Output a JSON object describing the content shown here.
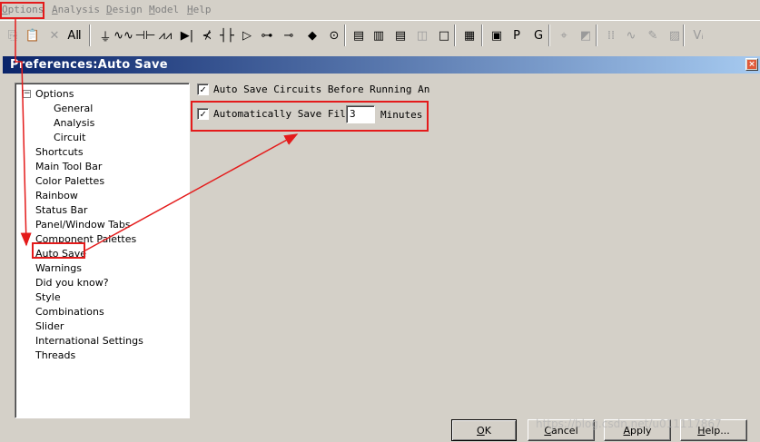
{
  "menubar": {
    "items": [
      {
        "label": "Options",
        "mnemonic": "O",
        "rest": "ptions"
      },
      {
        "label": "Analysis",
        "mnemonic": "A",
        "rest": "nalysis"
      },
      {
        "label": "Design",
        "mnemonic": "D",
        "rest": "esign"
      },
      {
        "label": "Model",
        "mnemonic": "M",
        "rest": "odel"
      },
      {
        "label": "Help",
        "mnemonic": "H",
        "rest": "elp"
      }
    ]
  },
  "toolbar": {
    "icons": [
      {
        "name": "copy-icon",
        "glyph": "⎘",
        "dim": true
      },
      {
        "name": "paste-icon",
        "glyph": "📋",
        "dim": false
      },
      {
        "name": "delete-icon",
        "glyph": "✕",
        "dim": true
      },
      {
        "name": "all-text-icon",
        "glyph": "AⅡ",
        "dim": false
      },
      {
        "name": "ground-icon",
        "glyph": "⏚",
        "dim": false
      },
      {
        "name": "inductor-icon",
        "glyph": "∿∿",
        "dim": false
      },
      {
        "name": "capacitor-icon",
        "glyph": "⊣⊢",
        "dim": false
      },
      {
        "name": "resistor-icon",
        "glyph": "⩘⩘",
        "dim": false
      },
      {
        "name": "diode-icon",
        "glyph": "▶|",
        "dim": false
      },
      {
        "name": "transistor-icon",
        "glyph": "⊀",
        "dim": false
      },
      {
        "name": "mosfet-icon",
        "glyph": "┤├",
        "dim": false
      },
      {
        "name": "opamp-icon",
        "glyph": "▷",
        "dim": false
      },
      {
        "name": "switch-icon",
        "glyph": "⊶",
        "dim": false
      },
      {
        "name": "wire-junction-icon",
        "glyph": "⊸",
        "dim": false
      },
      {
        "name": "node-icon",
        "glyph": "◆",
        "dim": false
      },
      {
        "name": "source-icon",
        "glyph": "⊙",
        "dim": false
      },
      {
        "name": "cascade-windows-icon",
        "glyph": "▤",
        "dim": false
      },
      {
        "name": "tile-vertical-icon",
        "glyph": "▥",
        "dim": false
      },
      {
        "name": "tile-horizontal-icon",
        "glyph": "▤",
        "dim": false
      },
      {
        "name": "split-window-icon",
        "glyph": "◫",
        "dim": true
      },
      {
        "name": "window-icon",
        "glyph": "□",
        "dim": false
      },
      {
        "name": "calculator-icon",
        "glyph": "▦",
        "dim": false
      },
      {
        "name": "schematic-window-icon",
        "glyph": "▣",
        "dim": false
      },
      {
        "name": "page-icon",
        "glyph": "P",
        "dim": false
      },
      {
        "name": "graph-icon",
        "glyph": "G",
        "dim": false
      },
      {
        "name": "probe-icon",
        "glyph": "⌖",
        "dim": true
      },
      {
        "name": "image-icon",
        "glyph": "◩",
        "dim": true
      },
      {
        "name": "grid-dots-icon",
        "glyph": "⁞⁞",
        "dim": true
      },
      {
        "name": "waveform-icon",
        "glyph": "∿",
        "dim": true
      },
      {
        "name": "pencil-icon",
        "glyph": "✎",
        "dim": true
      },
      {
        "name": "picture-icon",
        "glyph": "▨",
        "dim": true
      },
      {
        "name": "voltage-icon",
        "glyph": "Vᵢ",
        "dim": true
      }
    ]
  },
  "dialog": {
    "title": "Preferences:Auto Save",
    "tree": {
      "root": "Options",
      "toggle": "−",
      "items": [
        "General",
        "Analysis",
        "Circuit",
        "Shortcuts",
        "Main Tool Bar",
        "Color Palettes",
        "Rainbow",
        "Status Bar",
        "Panel/Window Tabs",
        "Component Palettes",
        "Auto Save",
        "Warnings",
        "Did you know?",
        "Style",
        "Combinations",
        "Slider",
        "International Settings",
        "Threads"
      ],
      "selected": "Auto Save"
    },
    "auto_save_before_run": {
      "label": "Auto Save Circuits Before Running An",
      "checked": true
    },
    "auto_save_file": {
      "label": "Automatically Save File I",
      "checked": true,
      "minutes_value": "3",
      "minutes_label": "Minutes"
    },
    "buttons": {
      "ok": {
        "label": "OK",
        "mnemonic": "O",
        "rest": "K"
      },
      "cancel": {
        "label": "Cancel",
        "mnemonic": "C",
        "rest": "ancel"
      },
      "apply": {
        "label": "Apply",
        "mnemonic": "A",
        "rest": "pply"
      },
      "help": {
        "label": "Help...",
        "mnemonic": "H",
        "rest": "elp..."
      }
    }
  },
  "watermark": "https://blog.csdn.net/u011117867",
  "colors": {
    "highlight": "#e41b1b",
    "titlebar_start": "#0a246a",
    "titlebar_end": "#a6caf0",
    "dialog_bg": "#d4d0c8"
  }
}
